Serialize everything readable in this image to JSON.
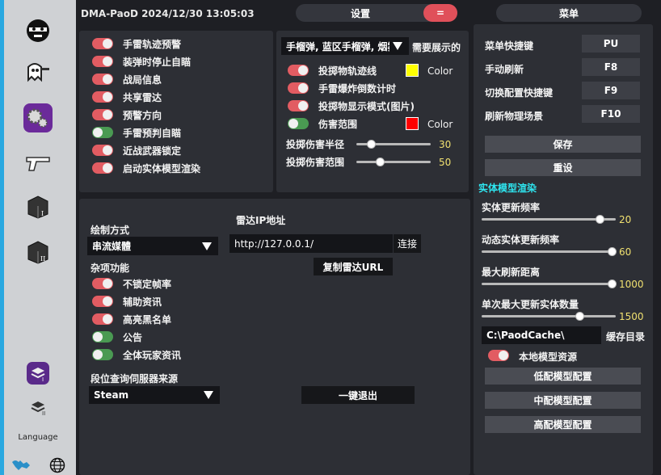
{
  "app": {
    "title": "DMA-PaoD 2024/12/30 13:05:03"
  },
  "header": {
    "settings_label": "设置",
    "settings_button": "=",
    "menu_label": "菜单"
  },
  "sidebar": {
    "language_label": "Language",
    "icons": [
      "mask-face-icon",
      "ghost-gun-icon",
      "gears-icon",
      "pistol-icon",
      "crate-1-icon",
      "crate-2-icon",
      "layers-1-icon",
      "layers-2-icon",
      "world-map-icon",
      "globe-icon"
    ]
  },
  "grenade_panel": {
    "items": [
      {
        "label": "手雷轨迹预警",
        "on": true
      },
      {
        "label": "装弹时停止自瞄",
        "on": true
      },
      {
        "label": "战局信息",
        "on": true
      },
      {
        "label": "共享雷达",
        "on": true
      },
      {
        "label": "预警方向",
        "on": true
      },
      {
        "label": "手雷预判自瞄",
        "on": false
      },
      {
        "label": "近战武器锁定",
        "on": true
      },
      {
        "label": "启动实体模型渲染",
        "on": true
      }
    ]
  },
  "throw_panel": {
    "dropdown_value": "手榴弹, 蓝区手榴弹, 烟雾",
    "dropdown_hint": "需要展示的",
    "items": [
      {
        "label": "投掷物轨迹线",
        "on": true
      },
      {
        "label": "手雷爆炸倒数计时",
        "on": true
      },
      {
        "label": "投掷物显示模式(图片)",
        "on": true
      },
      {
        "label": "伤害范围",
        "on": false
      }
    ],
    "color_label_1": "Color",
    "color_label_2": "Color",
    "color_1": "#ffff00",
    "color_2": "#ff0000",
    "slider_1": {
      "label": "投掷伤害半径",
      "value": "30",
      "fraction": 0.2
    },
    "slider_2": {
      "label": "投掷伤害范围",
      "value": "50",
      "fraction": 0.32
    }
  },
  "main_panel": {
    "draw_mode_label": "绘制方式",
    "draw_mode_value": "串流媒體",
    "misc_label": "杂项功能",
    "misc_items": [
      {
        "label": "不锁定帧率",
        "on": true
      },
      {
        "label": "辅助资讯",
        "on": true
      },
      {
        "label": "高亮黑名单",
        "on": true
      },
      {
        "label": "公告",
        "on": false
      },
      {
        "label": "全体玩家资讯",
        "on": false
      }
    ],
    "radar_ip_label": "雷达IP地址",
    "radar_ip_value": "http://127.0.0.1/",
    "connect_label": "连接",
    "copy_radar_label": "复制雷达URL",
    "server_source_label": "段位查询伺服器来源",
    "server_source_value": "Steam",
    "exit_label": "一键退出"
  },
  "menu_panel": {
    "hotkeys": [
      {
        "label": "菜单快捷键",
        "key": "PU"
      },
      {
        "label": "手动刷新",
        "key": "F8"
      },
      {
        "label": "切换配置快捷键",
        "key": "F9"
      },
      {
        "label": "刷新物理场景",
        "key": "F10"
      }
    ],
    "save_label": "保存",
    "reset_label": "重设",
    "entity_section_label": "实体模型渲染",
    "sliders": [
      {
        "label": "实体更新频率",
        "value": "20",
        "fraction": 0.88
      },
      {
        "label": "动态实体更新频率",
        "value": "60",
        "fraction": 0.97
      },
      {
        "label": "最大刷新距离",
        "value": "1000",
        "fraction": 0.97
      },
      {
        "label": "单次最大更新实体数量",
        "value": "1500",
        "fraction": 0.73
      }
    ],
    "cache_path_value": "C:\\PaodCache\\",
    "cache_dir_label": "缓存目录",
    "local_model_label": "本地模型资源",
    "local_model_on": true,
    "low_config_label": "低配模型配置",
    "mid_config_label": "中配模型配置",
    "high_config_label": "高配模型配置"
  }
}
